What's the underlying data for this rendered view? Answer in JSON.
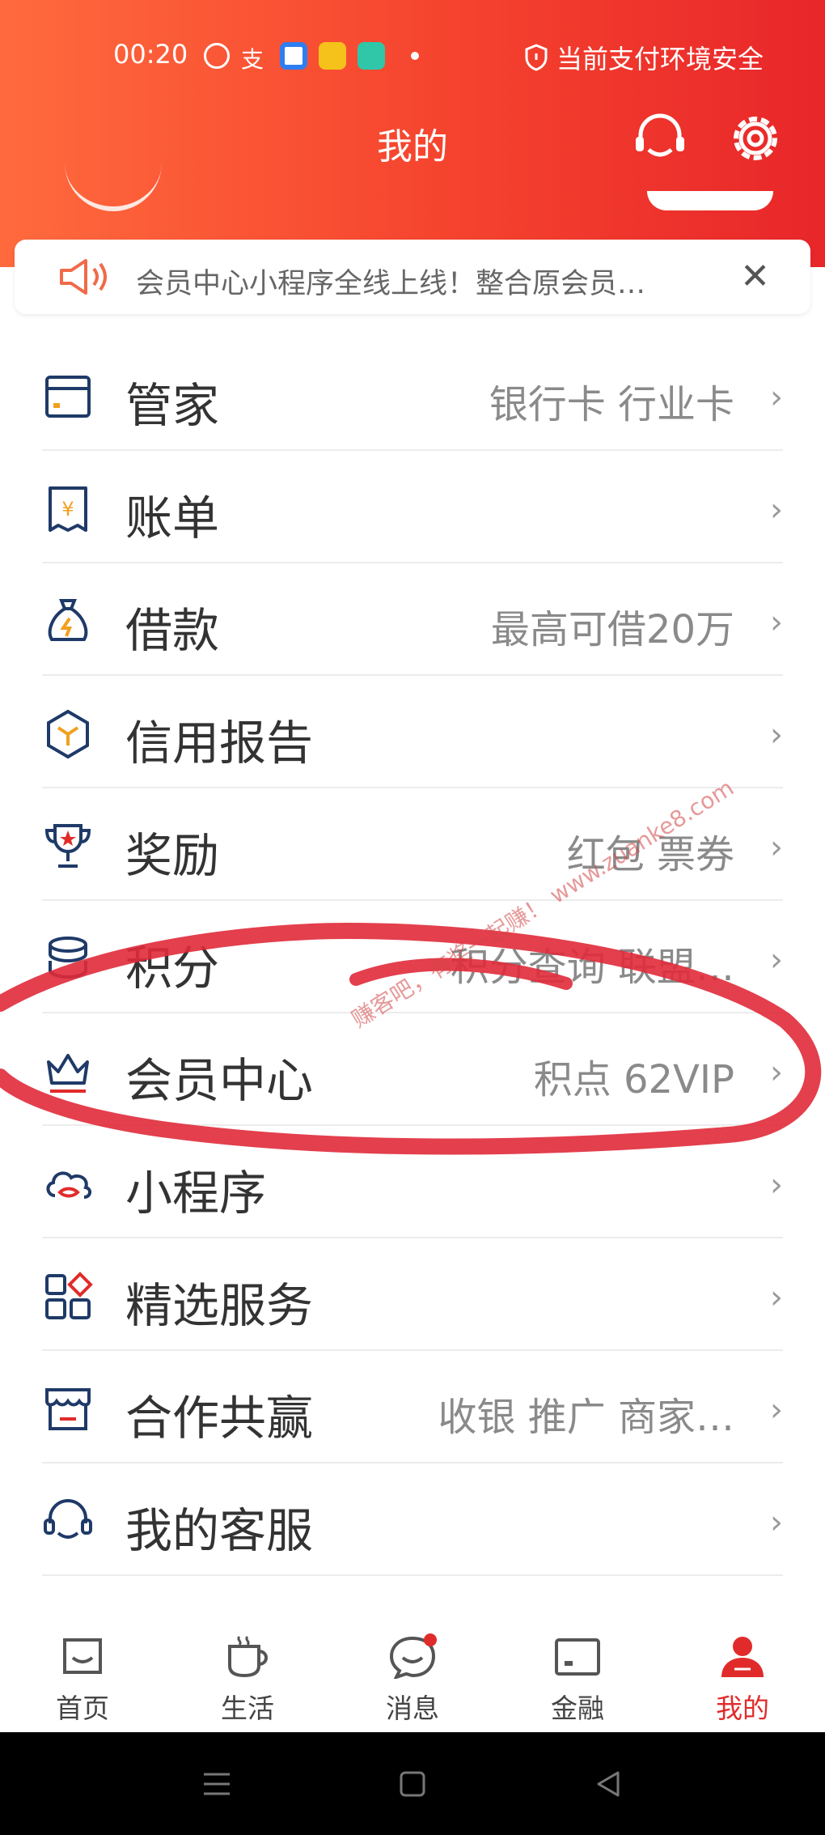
{
  "colors": {
    "brand": "#e8262a",
    "header_start": "#ff6a3d",
    "icon_navy": "#1f3a68",
    "text": "#333333",
    "value": "#8a8a8a"
  },
  "status_bar": {
    "time": "00:20",
    "safety": "当前支付环境安全"
  },
  "header": {
    "title": "我的",
    "icons": [
      "headset-icon",
      "gear-icon"
    ]
  },
  "notice": {
    "text": "会员中心小程序全线上线！整合原会员…",
    "close": "✕"
  },
  "menu": [
    {
      "label": "管家",
      "value": "银行卡 行业卡",
      "icon": "card-icon"
    },
    {
      "label": "账单",
      "value": "",
      "icon": "bill-icon"
    },
    {
      "label": "借款",
      "value": "最高可借20万",
      "icon": "money-bag-icon"
    },
    {
      "label": "信用报告",
      "value": "",
      "icon": "hexagon-icon"
    },
    {
      "label": "奖励",
      "value": "红包 票券",
      "icon": "trophy-icon"
    },
    {
      "label": "积分",
      "value": "积分查询 联盟…",
      "icon": "coins-icon"
    },
    {
      "label": "会员中心",
      "value": "积点 62VIP",
      "icon": "crown-icon"
    },
    {
      "label": "小程序",
      "value": "",
      "icon": "cloud-icon"
    },
    {
      "label": "精选服务",
      "value": "",
      "icon": "grid-icon"
    },
    {
      "label": "合作共赢",
      "value": "收银 推广 商家…",
      "icon": "shop-icon"
    },
    {
      "label": "我的客服",
      "value": "",
      "icon": "headset-icon"
    }
  ],
  "chevron": "›",
  "tabs": [
    {
      "label": "首页",
      "icon": "home-icon",
      "active": false
    },
    {
      "label": "生活",
      "icon": "cup-icon",
      "active": false
    },
    {
      "label": "消息",
      "icon": "message-icon",
      "active": false,
      "badge": true
    },
    {
      "label": "金融",
      "icon": "card-icon",
      "active": false
    },
    {
      "label": "我的",
      "icon": "person-icon",
      "active": true
    }
  ],
  "watermark": "赚客吧，有奖一起赚！ www.zuanke8.com"
}
